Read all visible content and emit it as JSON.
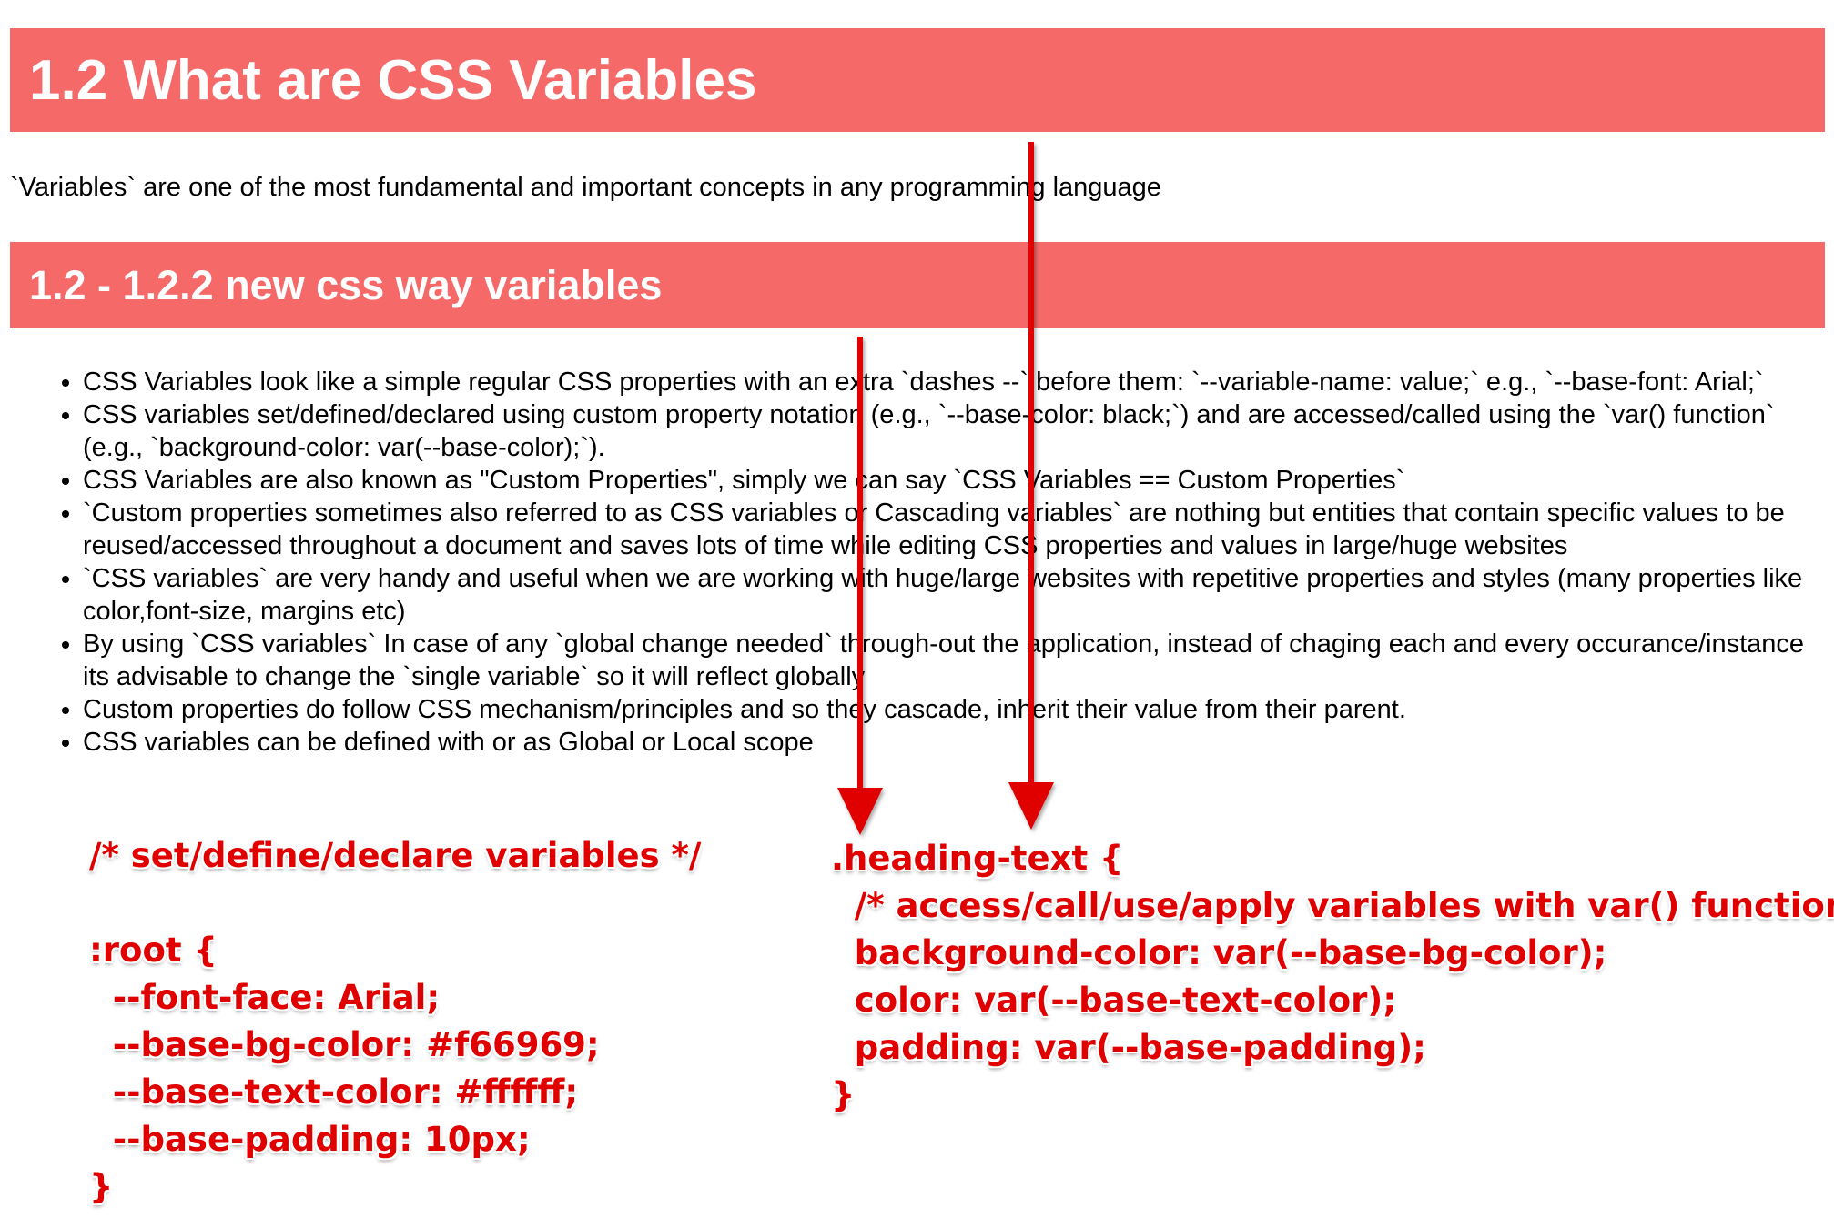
{
  "heading_1": "1.2 What are CSS Variables",
  "intro": "`Variables` are one of the most fundamental and important concepts in any programming language",
  "heading_2": "1.2 - 1.2.2 new css way variables",
  "bullets": [
    "CSS Variables look like a simple regular CSS properties with an extra `dashes --` before them: `--variable-name: value;` e.g., `--base-font: Arial;`",
    "CSS variables set/defined/declared using custom property notation (e.g., `--base-color: black;`) and are accessed/called using the `var() function` (e.g., `background-color: var(--base-color);`).",
    "CSS Variables are also known as \"Custom Properties\", simply we can say `CSS Variables == Custom Properties`",
    "`Custom properties sometimes also referred to as CSS variables or Cascading variables` are nothing but entities that contain specific values to be reused/accessed throughout a document and saves lots of time while editing CSS properties and values in large/huge websites",
    "`CSS variables` are very handy and useful when we are working with huge/large websites with repetitive properties and styles (many properties like color,font-size, margins etc)",
    "By using `CSS variables` In case of any `global change needed` through-out the application, instead of chaging each and every occurance/instance its advisable to change the `single variable` so it will reflect globally",
    "Custom properties do follow CSS mechanism/principles and so they cascade, inherit their value from their parent.",
    "CSS variables can be defined with or as Global or Local scope"
  ],
  "code_left": "/* set/define/declare variables */\n\n:root {\n  --font-face: Arial;\n  --base-bg-color: #f66969;\n  --base-text-color: #ffffff;\n  --base-padding: 10px;\n}",
  "code_right": ".heading-text {\n  /* access/call/use/apply variables with var() function*/\n  background-color: var(--base-bg-color);\n  color: var(--base-text-color);\n  padding: var(--base-padding);\n}",
  "colors": {
    "banner": "#f66969",
    "banner_text": "#ffffff",
    "annotation": "#e00000"
  }
}
